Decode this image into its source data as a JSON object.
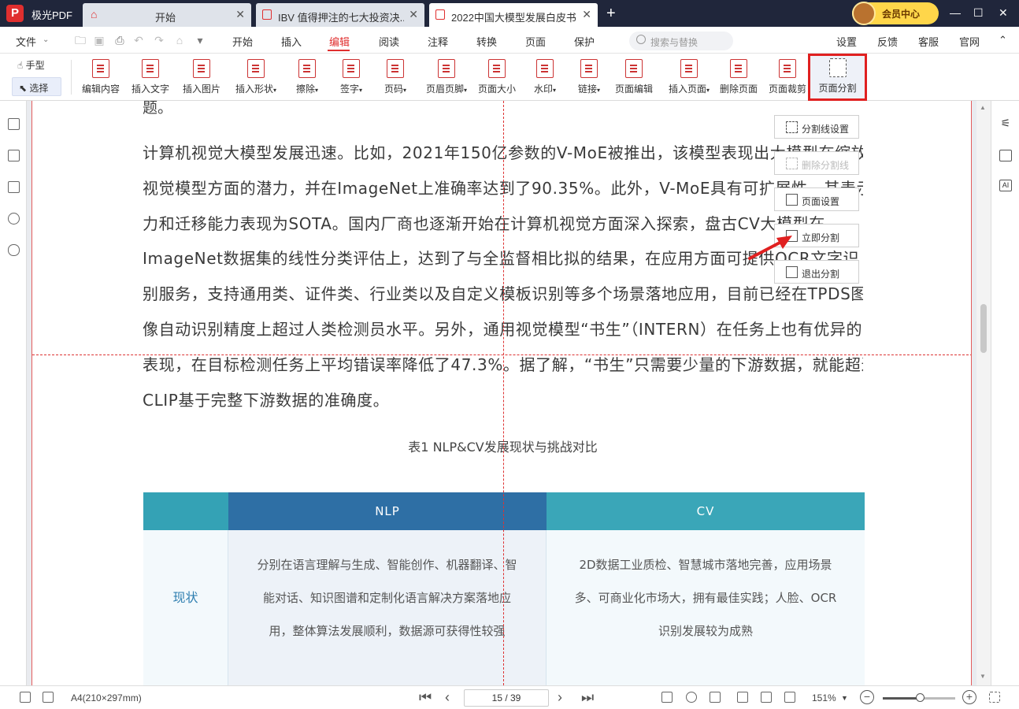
{
  "app": {
    "name": "极光PDF",
    "logo": "P"
  },
  "tabs": [
    {
      "label": "开始"
    },
    {
      "label": "IBV 值得押注的七大投资决..."
    },
    {
      "label": "2022中国大模型发展白皮书..."
    }
  ],
  "vip": {
    "label": "会员中心"
  },
  "menu": {
    "file": "文件",
    "items": [
      "开始",
      "插入",
      "编辑",
      "阅读",
      "注释",
      "转换",
      "页面",
      "保护"
    ],
    "active": "编辑",
    "search_placeholder": "搜索与替换",
    "right": [
      "设置",
      "反馈",
      "客服",
      "官网"
    ]
  },
  "toolbar": {
    "hand": "手型",
    "select": "选择",
    "buttons": [
      "编辑内容",
      "插入文字",
      "插入图片",
      "插入形状",
      "擦除",
      "签字",
      "页码",
      "页眉页脚",
      "页面大小",
      "水印",
      "链接",
      "页面编辑",
      "插入页面",
      "删除页面",
      "页面裁剪",
      "页面分割"
    ]
  },
  "document": {
    "top_fragment": "题。",
    "paragraph_lines": [
      "计算机视觉大模型发展迅速。比如，2021年150亿参数的V-MoE被推出，该模型表现出大模型在缩放",
      "视觉模型方面的潜力，并在ImageNet上准确率达到了90.35%。此外，V-MoE具有可扩展性，其表示能",
      "力和迁移能力表现为SOTA。国内厂商也逐渐开始在计算机视觉方面深入探索，盘古CV大模型在",
      "ImageNet数据集的线性分类评估上，达到了与全监督相比拟的结果，在应用方面可提供OCR文字识",
      "别服务，支持通用类、证件类、行业类以及自定义模板识别等多个场景落地应用，目前已经在TPDS图",
      "像自动识别精度上超过人类检测员水平。另外，通用视觉模型“书生”（INTERN）在任务上也有优异的",
      "表现，在目标检测任务上平均错误率降低了47.3%。据了解，“书生”只需要少量的下游数据，就能超过",
      "CLIP基于完整下游数据的准确度。"
    ],
    "table_caption": "表1 NLP&CV发展现状与挑战对比",
    "table": {
      "headers": [
        "",
        "NLP",
        "CV"
      ],
      "rows": [
        {
          "label": "现状",
          "nlp": [
            "分别在语言理解与生成、智能创作、机器翻译、智",
            "能对话、知识图谱和定制化语言解决方案落地应",
            "用，整体算法发展顺利，数据源可获得性较强"
          ],
          "cv": [
            "2D数据工业质检、智慧城市落地完善，应用场景",
            "多、可商业化市场大，拥有最佳实践；人脸、OCR",
            "识别发展较为成熟"
          ]
        }
      ]
    }
  },
  "split_panel": {
    "items": [
      "分割线设置",
      "删除分割线",
      "页面设置",
      "立即分割",
      "退出分割"
    ]
  },
  "status": {
    "page_size": "A4(210×297mm)",
    "page_indicator": "15 / 39",
    "zoom": "151%",
    "zoom_level": 0.52
  },
  "colors": {
    "accent": "#e02f2f",
    "header_nlp": "#2e6fa5",
    "header_cv": "#3aa6b8",
    "header_first": "#34a2b5"
  }
}
